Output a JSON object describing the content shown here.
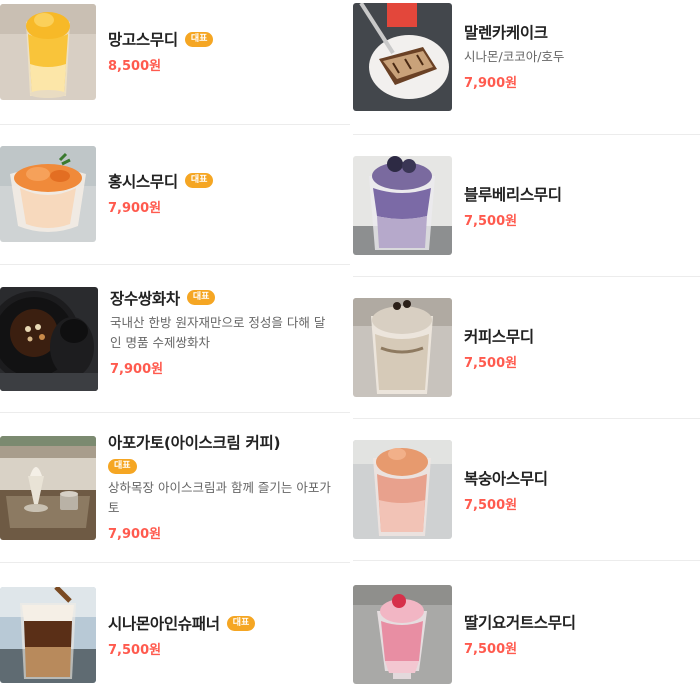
{
  "badge_label": "대표",
  "currency_color": "#ff5a4e",
  "badge_color": "#f5a623",
  "left_menu": [
    {
      "name": "망고스무디",
      "price": "8,500원",
      "badge": true
    },
    {
      "name": "홍시스무디",
      "price": "7,900원",
      "badge": true
    },
    {
      "name": "장수쌍화차",
      "price": "7,900원",
      "badge": true,
      "desc": "국내산 한방 원자재만으로 정성을 다해 달인 명품 수제쌍화차"
    },
    {
      "name": "아포가토(아이스크림 커피)",
      "price": "7,900원",
      "badge": true,
      "desc": "상하목장 아이스크림과 함께 즐기는 아포가토"
    },
    {
      "name": "시나몬아인슈패너",
      "price": "7,500원",
      "badge": true
    }
  ],
  "right_menu": [
    {
      "name": "말렌카케이크",
      "price": "7,900원",
      "desc": "시나몬/코코아/호두"
    },
    {
      "name": "블루베리스무디",
      "price": "7,500원"
    },
    {
      "name": "커피스무디",
      "price": "7,500원"
    },
    {
      "name": "복숭아스무디",
      "price": "7,500원"
    },
    {
      "name": "딸기요거트스무디",
      "price": "7,500원"
    }
  ]
}
